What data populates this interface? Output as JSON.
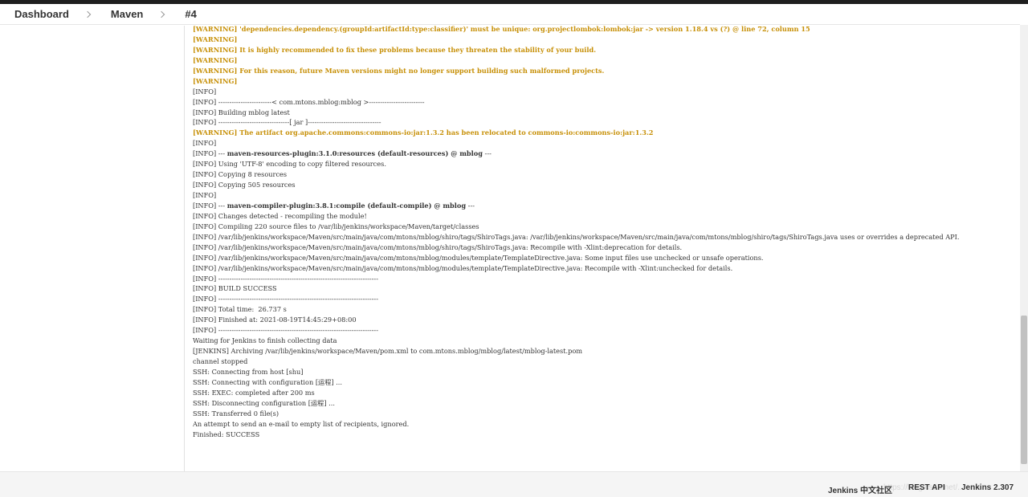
{
  "breadcrumb": {
    "items": [
      "Dashboard",
      "Maven",
      "#4"
    ]
  },
  "console": {
    "lines": [
      {
        "t": "[WARNING] 'dependencies.dependency.(groupId:artifactId:type:classifier)' must be unique: org.projectlombok:lombok:jar -> version 1.18.4 vs (?) @ line 72, column 15",
        "k": "warn"
      },
      {
        "t": "[WARNING]",
        "k": "warn"
      },
      {
        "t": "[WARNING] It is highly recommended to fix these problems because they threaten the stability of your build.",
        "k": "warn"
      },
      {
        "t": "[WARNING]",
        "k": "warn"
      },
      {
        "t": "[WARNING] For this reason, future Maven versions might no longer support building such malformed projects.",
        "k": "warn"
      },
      {
        "t": "[WARNING]",
        "k": "warn"
      },
      {
        "t": "[INFO]",
        "k": ""
      },
      {
        "t": "[INFO] ------------------------< com.mtons.mblog:mblog >-------------------------",
        "k": ""
      },
      {
        "t": "[INFO] Building mblog latest",
        "k": ""
      },
      {
        "t": "[INFO] --------------------------------[ jar ]---------------------------------",
        "k": ""
      },
      {
        "t": "[WARNING] The artifact org.apache.commons:commons-io:jar:1.3.2 has been relocated to commons-io:commons-io:jar:1.3.2",
        "k": "warn"
      },
      {
        "t": "[INFO]",
        "k": ""
      },
      {
        "p": "[INFO] --- ",
        "b": "maven-resources-plugin:3.1.0:resources (default-resources) @ mblog",
        "s": " ---"
      },
      {
        "t": "[INFO] Using 'UTF-8' encoding to copy filtered resources.",
        "k": ""
      },
      {
        "t": "[INFO] Copying 8 resources",
        "k": ""
      },
      {
        "t": "[INFO] Copying 505 resources",
        "k": ""
      },
      {
        "t": "[INFO]",
        "k": ""
      },
      {
        "p": "[INFO] --- ",
        "b": "maven-compiler-plugin:3.8.1:compile (default-compile) @ mblog",
        "s": " ---"
      },
      {
        "t": "[INFO] Changes detected - recompiling the module!",
        "k": ""
      },
      {
        "t": "[INFO] Compiling 220 source files to /var/lib/jenkins/workspace/Maven/target/classes",
        "k": ""
      },
      {
        "t": "[INFO] /var/lib/jenkins/workspace/Maven/src/main/java/com/mtons/mblog/shiro/tags/ShiroTags.java: /var/lib/jenkins/workspace/Maven/src/main/java/com/mtons/mblog/shiro/tags/ShiroTags.java uses or overrides a deprecated API.",
        "k": "wrap"
      },
      {
        "t": "[INFO] /var/lib/jenkins/workspace/Maven/src/main/java/com/mtons/mblog/shiro/tags/ShiroTags.java: Recompile with -Xlint:deprecation for details.",
        "k": ""
      },
      {
        "t": "[INFO] /var/lib/jenkins/workspace/Maven/src/main/java/com/mtons/mblog/modules/template/TemplateDirective.java: Some input files use unchecked or unsafe operations.",
        "k": ""
      },
      {
        "t": "[INFO] /var/lib/jenkins/workspace/Maven/src/main/java/com/mtons/mblog/modules/template/TemplateDirective.java: Recompile with -Xlint:unchecked for details.",
        "k": ""
      },
      {
        "t": "[INFO] ------------------------------------------------------------------------",
        "k": ""
      },
      {
        "t": "[INFO] BUILD SUCCESS",
        "k": ""
      },
      {
        "t": "[INFO] ------------------------------------------------------------------------",
        "k": ""
      },
      {
        "t": "[INFO] Total time:  26.737 s",
        "k": ""
      },
      {
        "t": "[INFO] Finished at: 2021-08-19T14:45:29+08:00",
        "k": ""
      },
      {
        "t": "[INFO] ------------------------------------------------------------------------",
        "k": ""
      },
      {
        "t": "Waiting for Jenkins to finish collecting data",
        "k": ""
      },
      {
        "t": "[JENKINS] Archiving /var/lib/jenkins/workspace/Maven/pom.xml to com.mtons.mblog/mblog/latest/mblog-latest.pom",
        "k": ""
      },
      {
        "t": "channel stopped",
        "k": ""
      },
      {
        "t": "SSH: Connecting from host [shu]",
        "k": ""
      },
      {
        "t": "SSH: Connecting with configuration [运程] ...",
        "k": ""
      },
      {
        "t": "SSH: EXEC: completed after 200 ms",
        "k": ""
      },
      {
        "t": "SSH: Disconnecting configuration [运程] ...",
        "k": ""
      },
      {
        "t": "SSH: Transferred 0 file(s)",
        "k": ""
      },
      {
        "t": "An attempt to send an e-mail to empty list of recipients, ignored.",
        "k": ""
      },
      {
        "t": "Finished: SUCCESS",
        "k": ""
      }
    ]
  },
  "footer": {
    "community": "Jenkins 中文社区",
    "rest_api": "REST API",
    "version": "Jenkins 2.307",
    "watermark": "https://blog.csdn.net/..."
  },
  "colors": {
    "warning": "#c79008",
    "text": "#333333"
  }
}
